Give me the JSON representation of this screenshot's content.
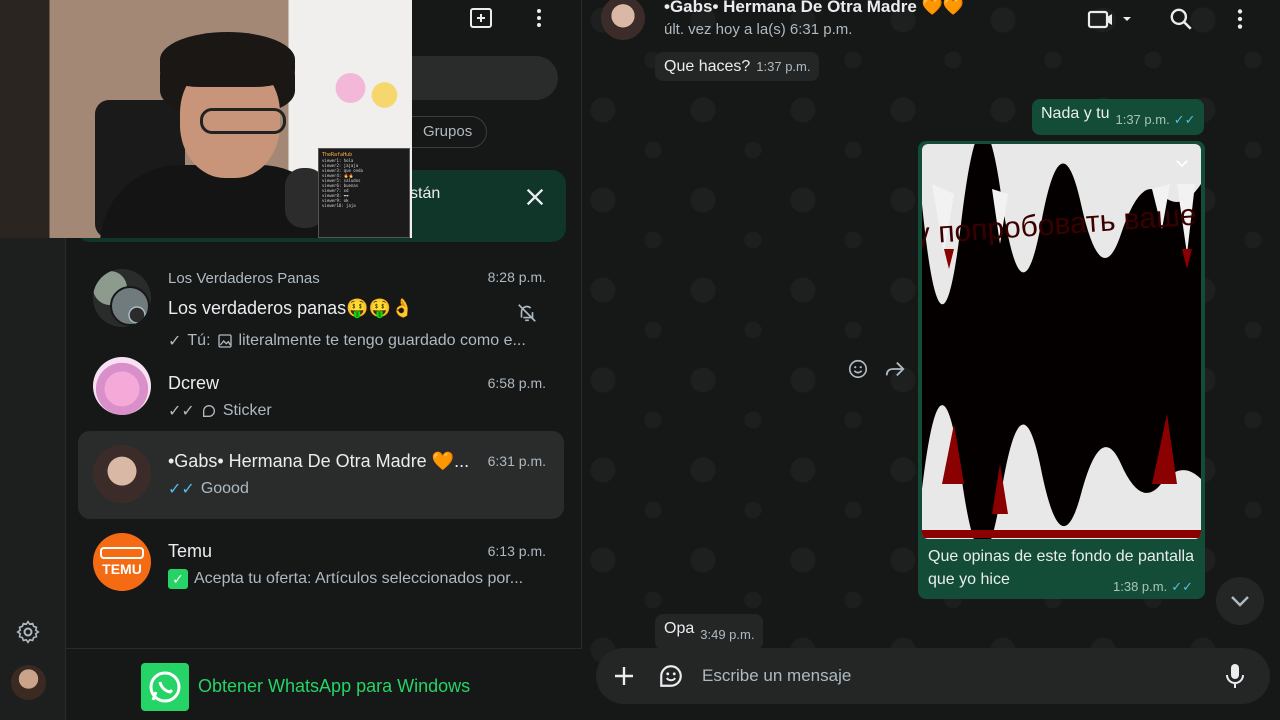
{
  "chat_list": {
    "filter_chip": "Grupos",
    "banner_text": "stán",
    "chats": [
      {
        "group_label": "Los Verdaderos Panas",
        "name": "Los verdaderos panas🤑🤑👌",
        "time": "8:28 p.m.",
        "last_prefix": "Tú:",
        "last": "literalmente te tengo guardado como e...",
        "muted": true
      },
      {
        "name": "Dcrew",
        "time": "6:58 p.m.",
        "last": "Sticker"
      },
      {
        "name": "•Gabs• Hermana De Otra Madre 🧡...",
        "time": "6:31 p.m.",
        "last": "Goood",
        "active": true
      },
      {
        "name": "Temu",
        "time": "6:13 p.m.",
        "last": "Acepta tu oferta: Artículos seleccionados por..."
      }
    ],
    "get_windows": "Obtener WhatsApp para Windows"
  },
  "conversation": {
    "title": "•Gabs• Hermana De Otra Madre 🧡🧡",
    "subtitle": "últ. vez hoy a la(s) 6:31 p.m.",
    "messages": [
      {
        "dir": "in",
        "text": "Que haces?",
        "time": "1:37 p.m."
      },
      {
        "dir": "out",
        "text": "Nada y tu",
        "time": "1:37 p.m.",
        "ticks": "✓✓"
      },
      {
        "dir": "out",
        "type": "image",
        "image_text": "Я хочу попробовать ваше мясо!",
        "caption": "Que opinas de este fondo de pantalla que yo hice",
        "time": "1:38 p.m.",
        "ticks": "✓✓"
      },
      {
        "dir": "in",
        "text": "Opa",
        "time": "3:49 p.m."
      }
    ]
  },
  "composer": {
    "placeholder": "Escribe un mensaje"
  },
  "stream_chat": {
    "title": "TheRafaHub",
    "lines": [
      "viewer1: hola",
      "viewer2: jajaja",
      "viewer3: que onda",
      "viewer4: 🔥🔥",
      "viewer5: saludos",
      "viewer6: buenas",
      "viewer7: xd",
      "viewer8: ❤❤",
      "viewer9: ok",
      "viewer10: jaja"
    ]
  },
  "colors": {
    "accent_green": "#25d366",
    "outgoing_bubble": "#144d37",
    "incoming_bubble": "#242626",
    "read_ticks": "#53bdeb"
  }
}
